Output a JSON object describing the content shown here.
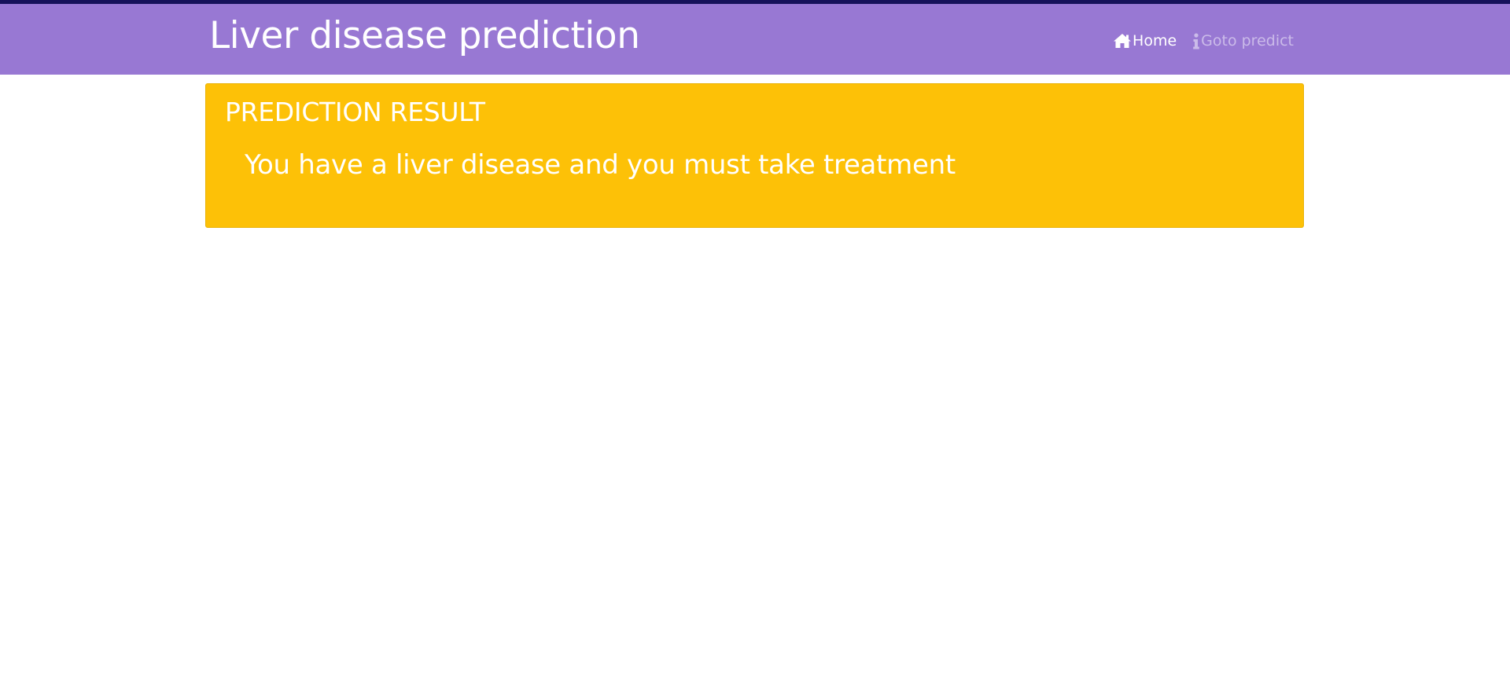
{
  "app": {
    "title": "Liver disease prediction"
  },
  "nav": {
    "items": [
      {
        "label": "Home",
        "icon": "home-icon",
        "active": true
      },
      {
        "label": "Goto predict",
        "icon": "info-icon",
        "active": false
      }
    ]
  },
  "result": {
    "heading": "PREDICTION RESULT",
    "message": "You have a liver disease and you must take treatment"
  },
  "colors": {
    "top_strip": "#16125a",
    "navbar": "#9878d3",
    "panel": "#fdc107",
    "text": "#ffffff",
    "inactive_link": "#cbbbe9"
  }
}
